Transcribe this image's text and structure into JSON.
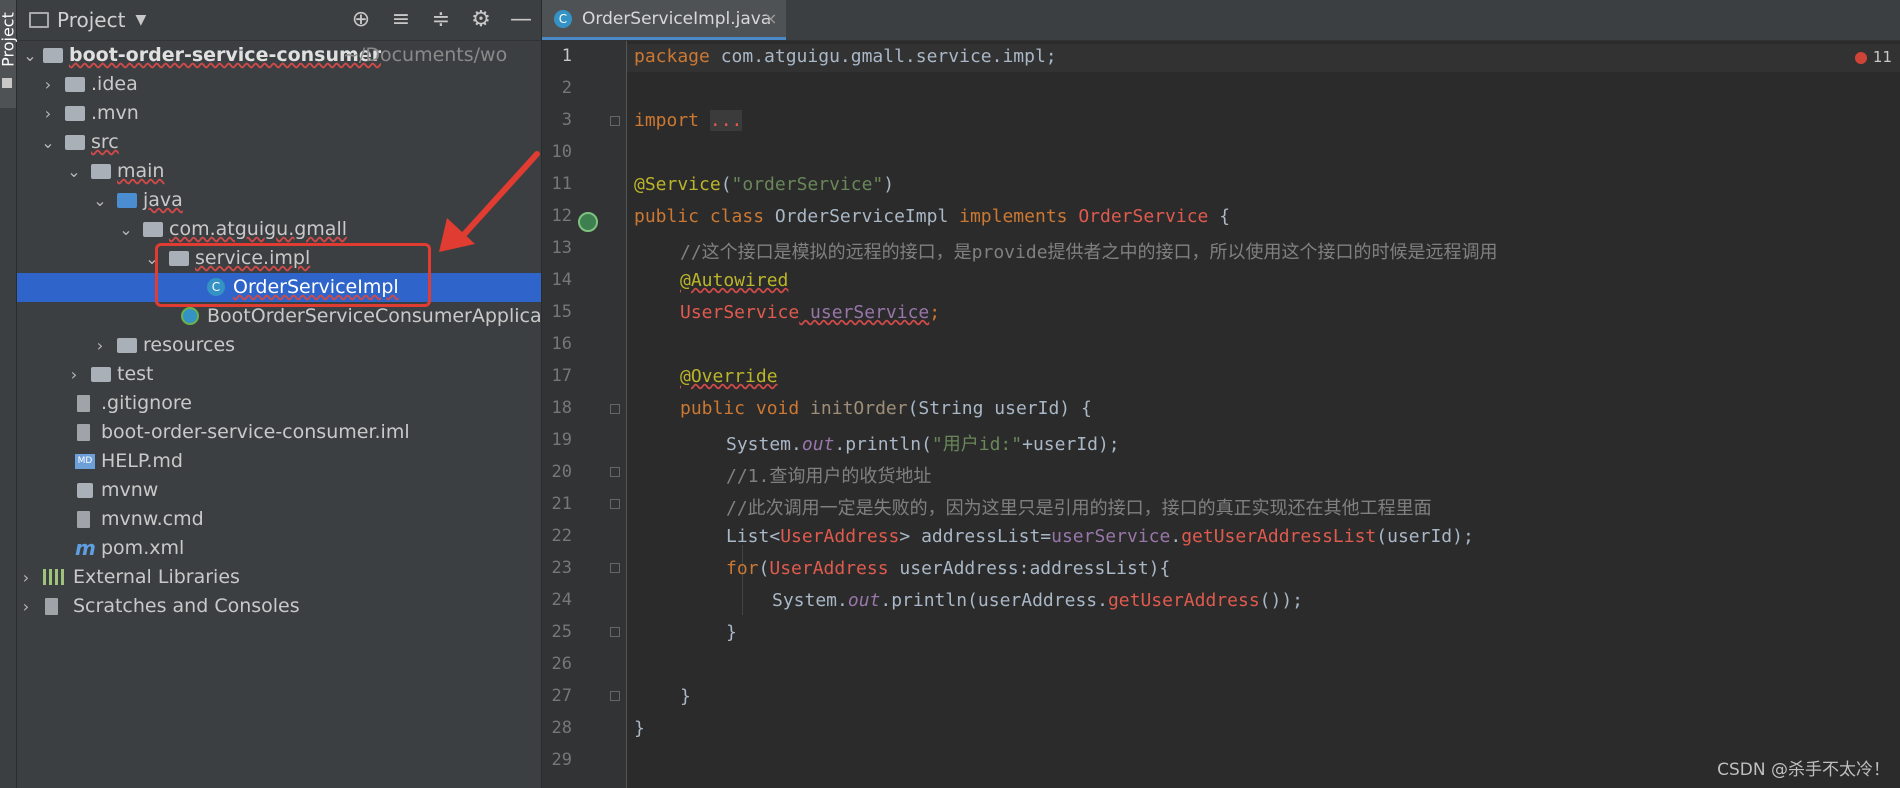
{
  "sidebar_stripe": {
    "label": "Project"
  },
  "project_panel": {
    "title": "Project",
    "root": {
      "name": "boot-order-service-consumer",
      "path": "~/Documents/wo"
    },
    "items": [
      {
        "label": ".idea"
      },
      {
        "label": ".mvn"
      },
      {
        "label": "src"
      },
      {
        "label": "main"
      },
      {
        "label": "java"
      },
      {
        "label": "com.atguigu.gmall"
      },
      {
        "label": "service.impl"
      },
      {
        "label": "OrderServiceImpl"
      },
      {
        "label": "BootOrderServiceConsumerApplicat"
      },
      {
        "label": "resources"
      },
      {
        "label": "test"
      },
      {
        "label": ".gitignore"
      },
      {
        "label": "boot-order-service-consumer.iml"
      },
      {
        "label": "HELP.md"
      },
      {
        "label": "mvnw"
      },
      {
        "label": "mvnw.cmd"
      },
      {
        "label": "pom.xml"
      },
      {
        "label": "External Libraries"
      },
      {
        "label": "Scratches and Consoles"
      }
    ]
  },
  "editor": {
    "tab": {
      "label": "OrderServiceImpl.java"
    },
    "error_count": "11",
    "line_numbers": [
      "1",
      "2",
      "3",
      "10",
      "11",
      "12",
      "13",
      "14",
      "15",
      "16",
      "17",
      "18",
      "19",
      "20",
      "21",
      "22",
      "23",
      "24",
      "25",
      "26",
      "27",
      "28",
      "29"
    ],
    "code": {
      "l1_kw": "package",
      "l1_rest": " com.atguigu.gmall.service.impl;",
      "l3_kw": "import",
      "l3_fold": "...",
      "l11_ann": "@Service",
      "l11_p1": "(",
      "l11_str": "\"orderService\"",
      "l11_p2": ")",
      "l12_kw1": "public class",
      "l12_name": " OrderServiceImpl ",
      "l12_kw2": "implements",
      "l12_iface": " OrderService",
      "l12_brace": " {",
      "l13_comment": "//这个接口是模拟的远程的接口，是provide提供者之中的接口，所以使用这个接口的时候是远程调用",
      "l14_ann": "@Autowired",
      "l15_type": "UserService",
      "l15_field": " userService",
      "l15_semi": ";",
      "l17_ann": "@Override",
      "l18_kw": "public void",
      "l18_name": " initOrder",
      "l18_rest": "(String userId) {",
      "l19_a": "System.",
      "l19_out": "out",
      "l19_b": ".println(",
      "l19_str": "\"用户id:\"",
      "l19_c": "+userId);",
      "l20_comment": "//1.查询用户的收货地址",
      "l21_comment": "//此次调用一定是失败的，因为这里只是引用的接口，接口的真正实现还在其他工程里面",
      "l22_a": "List<",
      "l22_type": "UserAddress",
      "l22_b": "> addressList=",
      "l22_field": "userService",
      "l22_c": ".",
      "l22_m": "getUserAddressList",
      "l22_d": "(userId);",
      "l23_kw": "for",
      "l23_a": "(",
      "l23_type": "UserAddress",
      "l23_b": " userAddress:addressList){",
      "l24_a": "System.",
      "l24_out": "out",
      "l24_b": ".println(userAddress.",
      "l24_m": "getUserAddress",
      "l24_c": "());",
      "l25": "}",
      "l27": "}",
      "l28": "}"
    }
  },
  "watermark": "CSDN @杀手不太冷！"
}
